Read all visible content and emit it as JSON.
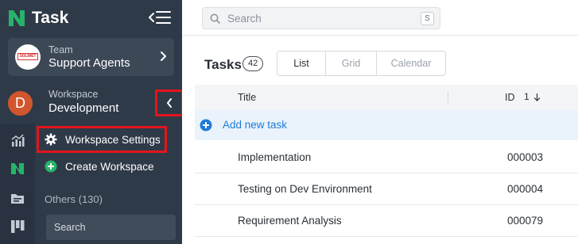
{
  "app": {
    "name": "Task"
  },
  "colors": {
    "sidebar": "#2f3a48",
    "accent": "#1d7bd8",
    "brand_green": "#27b36b",
    "highlight_red": "#e4141b",
    "workspace_avatar": "#d2562d"
  },
  "team": {
    "label": "Team",
    "name": "Support Agents",
    "logo_text": "SOLIMET"
  },
  "workspace": {
    "label": "Workspace",
    "name": "Development",
    "avatar_letter": "D"
  },
  "workspace_menu": {
    "items": [
      {
        "label": "Workspace Settings",
        "icon": "gear-icon"
      },
      {
        "label": "Create Workspace",
        "icon": "plus-circle-icon"
      }
    ],
    "others_label": "Others (130)",
    "search_label": "Search"
  },
  "rail": {
    "icons": [
      "chart-icon",
      "brand-icon",
      "folder-icon",
      "board-icon"
    ]
  },
  "search": {
    "placeholder": "Search",
    "shortcut": "S"
  },
  "tasks": {
    "title": "Tasks",
    "count": "42",
    "views": [
      "List",
      "Grid",
      "Calendar"
    ],
    "active_view": "List",
    "columns": {
      "title": "Title",
      "id": "ID",
      "sort_order": "1"
    },
    "add_label": "Add new task",
    "rows": [
      {
        "title": "Implementation",
        "id": "000003"
      },
      {
        "title": "Testing on Dev Environment",
        "id": "000004"
      },
      {
        "title": "Requirement Analysis",
        "id": "000079"
      }
    ]
  }
}
